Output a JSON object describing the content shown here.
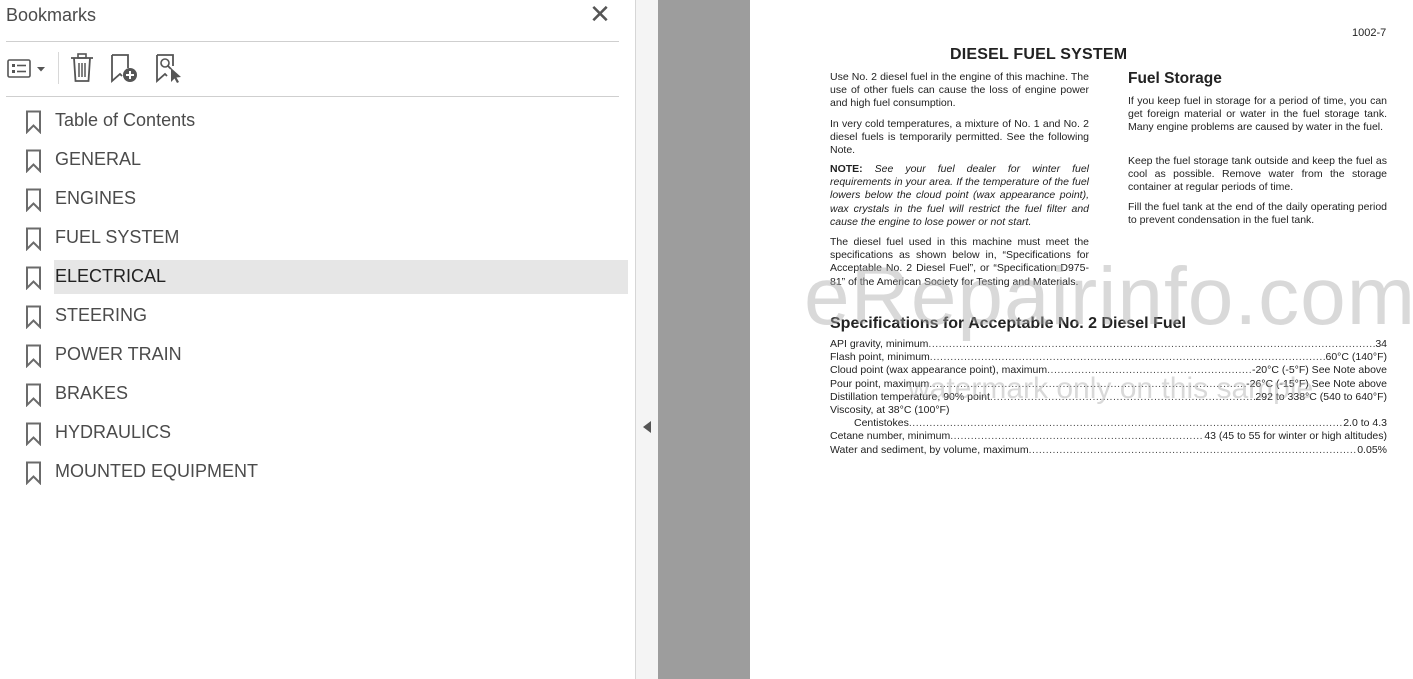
{
  "bookmarks_panel": {
    "title": "Bookmarks",
    "close_icon": "close-icon",
    "toolbar": {
      "options_icon": "list-options-icon",
      "delete_icon": "trash-icon",
      "new_bookmark_icon": "bookmark-add-icon",
      "find_bookmark_icon": "bookmark-find-icon"
    },
    "items": [
      {
        "label": "Table of Contents"
      },
      {
        "label": "GENERAL"
      },
      {
        "label": "ENGINES"
      },
      {
        "label": "FUEL SYSTEM"
      },
      {
        "label": "ELECTRICAL",
        "selected": true
      },
      {
        "label": "STEERING"
      },
      {
        "label": "POWER TRAIN"
      },
      {
        "label": "BRAKES"
      },
      {
        "label": "HYDRAULICS"
      },
      {
        "label": "MOUNTED EQUIPMENT"
      }
    ]
  },
  "document": {
    "page_number": "1002-7",
    "title": "DIESEL FUEL SYSTEM",
    "left_column": {
      "p1": "Use No. 2 diesel fuel in the engine of this machine. The use of other fuels can cause the loss of engine power and high fuel consumption.",
      "p2": "In very cold temperatures, a mixture of No. 1 and No. 2 diesel fuels is temporarily permitted. See the following Note.",
      "note_label": "NOTE:",
      "note_text": "See your fuel dealer for winter fuel requirements in your area. If the temperature of the fuel lowers below the cloud point (wax appearance point), wax crystals in the fuel will restrict the fuel filter and cause the engine to lose power or not start.",
      "p3": "The diesel fuel used in this machine must meet the specifications as shown below in, “Specifications for Acceptable No. 2 Diesel Fuel”, or “Specification D975-81” of the American Society for Testing and Materials."
    },
    "right_column": {
      "heading": "Fuel Storage",
      "p1": "If you keep fuel in storage for a period of time, you can get foreign material or water in the fuel storage tank. Many engine problems are caused by water in the fuel.",
      "p2": "Keep the fuel storage tank outside and keep the fuel as cool as possible. Remove water from the storage container at regular periods of time.",
      "p3": "Fill the fuel tank at the end of the daily operating period to prevent condensation in the fuel tank."
    },
    "specs_heading": "Specifications for Acceptable No. 2 Diesel Fuel",
    "specs": [
      {
        "label": "API gravity, minimum",
        "value": "34"
      },
      {
        "label": "Flash point, minimum",
        "value": "60°C (140°F)"
      },
      {
        "label": "Cloud point (wax appearance point), maximum",
        "value": "-20°C (-5°F) See Note above"
      },
      {
        "label": "Pour point, maximum",
        "value": "-26°C (-15°F) See Note above"
      },
      {
        "label": "Distillation temperature, 90% point",
        "value": "292 to 338°C (540 to 640°F)"
      },
      {
        "label": "Viscosity, at 38°C (100°F)",
        "value": ""
      },
      {
        "label": "Centistokes",
        "value": "2.0 to 4.3"
      },
      {
        "label": "Cetane number, minimum",
        "value": "43 (45 to 55 for winter or high altitudes)"
      },
      {
        "label": "Water and sediment, by volume, maximum",
        "value": "0.05%"
      }
    ],
    "watermark": "eRepairinfo.com",
    "watermark_sub": "watermark only on this sample"
  }
}
